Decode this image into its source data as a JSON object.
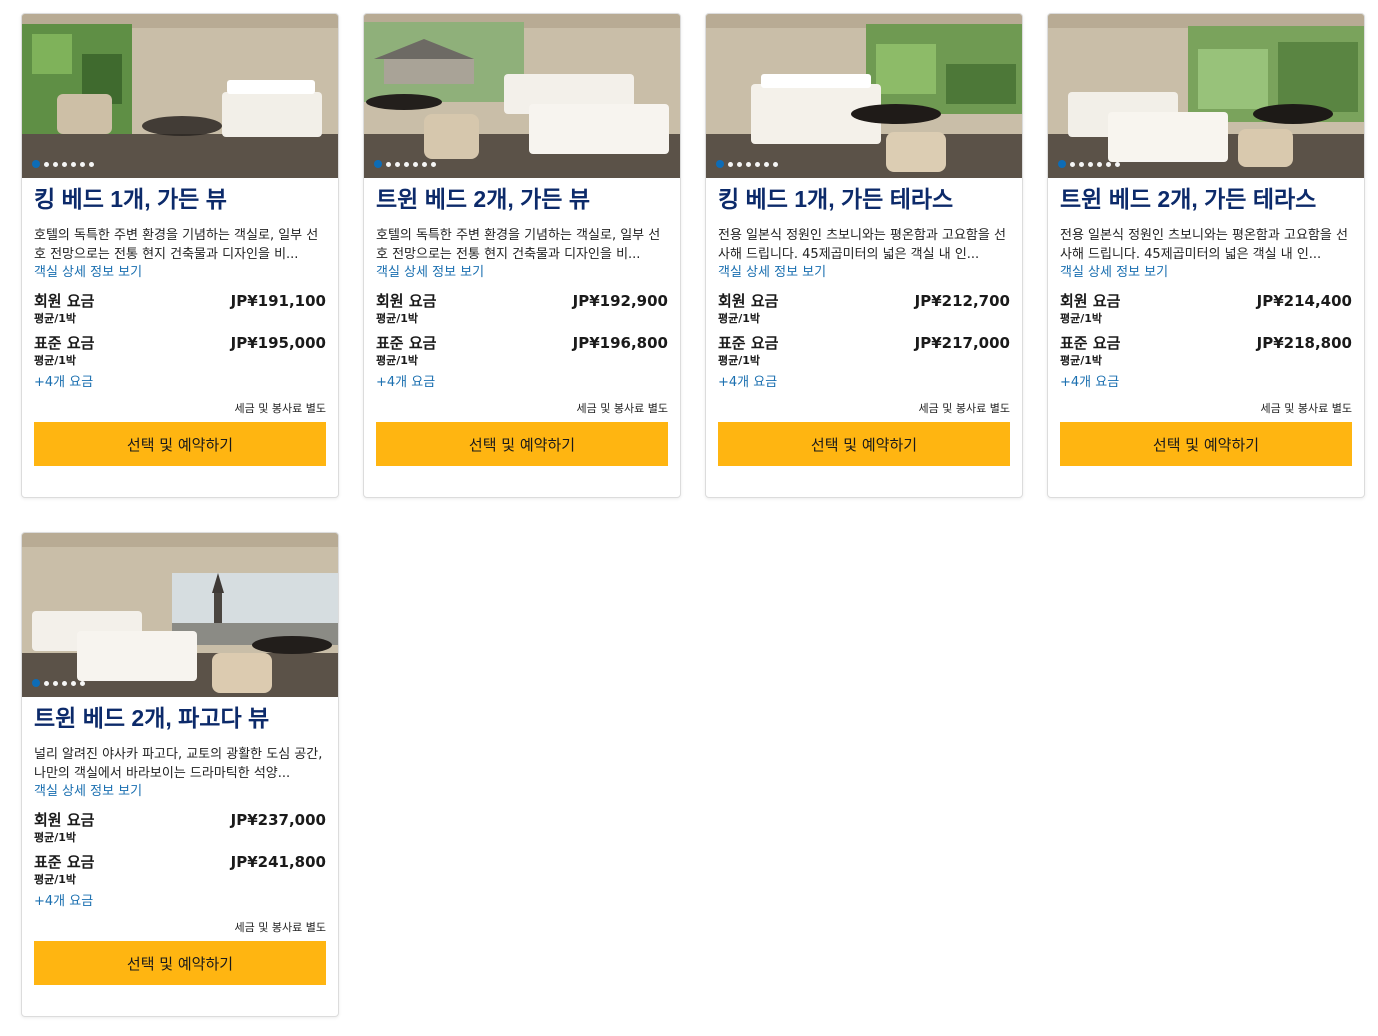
{
  "rooms": [
    {
      "title": "킹 베드 1개, 가든 뷰",
      "description": "호텔의 독특한 주변 환경을 기념하는 객실로, 일부 선호 전망으로는 전통 현지 건축물과 디자인을 비...",
      "details_link": "객실 상세 정보 보기",
      "member_rate": {
        "label": "회원 요금",
        "per": "평균/1박",
        "price": "JP¥191,100"
      },
      "standard_rate": {
        "label": "표준 요금",
        "per": "평균/1박",
        "price": "JP¥195,000"
      },
      "more_rates": "+4개 요금",
      "tax_note": "세금 및 봉사료 별도",
      "button": "선택 및 예약하기",
      "photo_count": 7,
      "scene": "garden-king"
    },
    {
      "title": "트윈 베드 2개, 가든 뷰",
      "description": "호텔의 독특한 주변 환경을 기념하는 객실로, 일부 선호 전망으로는 전통 현지 건축물과 디자인을 비...",
      "details_link": "객실 상세 정보 보기",
      "member_rate": {
        "label": "회원 요금",
        "per": "평균/1박",
        "price": "JP¥192,900"
      },
      "standard_rate": {
        "label": "표준 요금",
        "per": "평균/1박",
        "price": "JP¥196,800"
      },
      "more_rates": "+4개 요금",
      "tax_note": "세금 및 봉사료 별도",
      "button": "선택 및 예약하기",
      "photo_count": 7,
      "scene": "garden-twin"
    },
    {
      "title": "킹 베드 1개, 가든 테라스",
      "description": "전용 일본식 정원인 츠보니와는 평온함과 고요함을 선사해 드립니다. 45제곱미터의 넓은 객실 내 인...",
      "details_link": "객실 상세 정보 보기",
      "member_rate": {
        "label": "회원 요금",
        "per": "평균/1박",
        "price": "JP¥212,700"
      },
      "standard_rate": {
        "label": "표준 요금",
        "per": "평균/1박",
        "price": "JP¥217,000"
      },
      "more_rates": "+4개 요금",
      "tax_note": "세금 및 봉사료 별도",
      "button": "선택 및 예약하기",
      "photo_count": 7,
      "scene": "terrace-king"
    },
    {
      "title": "트윈 베드 2개, 가든 테라스",
      "description": "전용 일본식 정원인 츠보니와는 평온함과 고요함을 선사해 드립니다. 45제곱미터의 넓은 객실 내 인...",
      "details_link": "객실 상세 정보 보기",
      "member_rate": {
        "label": "회원 요금",
        "per": "평균/1박",
        "price": "JP¥214,400"
      },
      "standard_rate": {
        "label": "표준 요금",
        "per": "평균/1박",
        "price": "JP¥218,800"
      },
      "more_rates": "+4개 요금",
      "tax_note": "세금 및 봉사료 별도",
      "button": "선택 및 예약하기",
      "photo_count": 7,
      "scene": "terrace-twin"
    },
    {
      "title": "트윈 베드 2개, 파고다 뷰",
      "description": "널리 알려진 야사카 파고다, 교토의 광활한 도심 공간, 나만의 객실에서 바라보이는 드라마틱한 석양...",
      "details_link": "객실 상세 정보 보기",
      "member_rate": {
        "label": "회원 요금",
        "per": "평균/1박",
        "price": "JP¥237,000"
      },
      "standard_rate": {
        "label": "표준 요금",
        "per": "평균/1박",
        "price": "JP¥241,800"
      },
      "more_rates": "+4개 요금",
      "tax_note": "세금 및 봉사료 별도",
      "button": "선택 및 예약하기",
      "photo_count": 6,
      "scene": "pagoda-twin"
    }
  ],
  "colors": {
    "title": "#0c2a6a",
    "link": "#1a6fb0",
    "button": "#ffb511",
    "dot_active": "#0a6ebd"
  }
}
